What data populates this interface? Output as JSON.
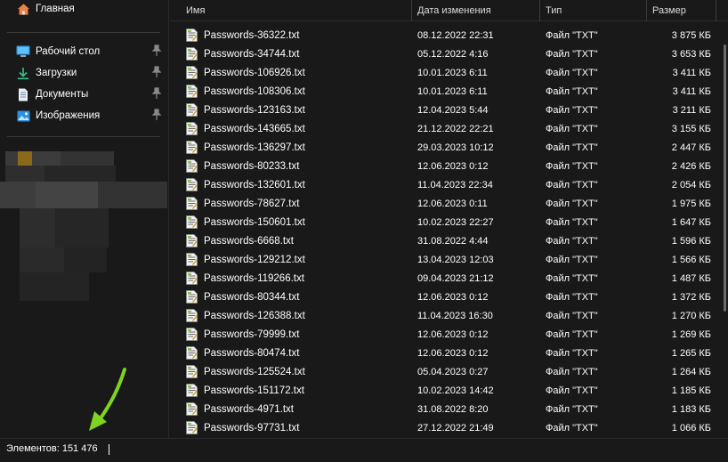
{
  "sidebar": {
    "home": {
      "label": "Главная",
      "icon": "home-icon"
    },
    "quick": [
      {
        "label": "Рабочий стол",
        "icon": "desktop-icon"
      },
      {
        "label": "Загрузки",
        "icon": "download-icon"
      },
      {
        "label": "Документы",
        "icon": "document-icon"
      },
      {
        "label": "Изображения",
        "icon": "image-icon"
      }
    ]
  },
  "columns": {
    "name": "Имя",
    "date": "Дата изменения",
    "type": "Тип",
    "size": "Размер"
  },
  "files": [
    {
      "name": "Passwords-36322.txt",
      "date": "08.12.2022 22:31",
      "type": "Файл \"TXT\"",
      "size": "3 875 КБ"
    },
    {
      "name": "Passwords-34744.txt",
      "date": "05.12.2022 4:16",
      "type": "Файл \"TXT\"",
      "size": "3 653 КБ"
    },
    {
      "name": "Passwords-106926.txt",
      "date": "10.01.2023 6:11",
      "type": "Файл \"TXT\"",
      "size": "3 411 КБ"
    },
    {
      "name": "Passwords-108306.txt",
      "date": "10.01.2023 6:11",
      "type": "Файл \"TXT\"",
      "size": "3 411 КБ"
    },
    {
      "name": "Passwords-123163.txt",
      "date": "12.04.2023 5:44",
      "type": "Файл \"TXT\"",
      "size": "3 211 КБ"
    },
    {
      "name": "Passwords-143665.txt",
      "date": "21.12.2022 22:21",
      "type": "Файл \"TXT\"",
      "size": "3 155 КБ"
    },
    {
      "name": "Passwords-136297.txt",
      "date": "29.03.2023 10:12",
      "type": "Файл \"TXT\"",
      "size": "2 447 КБ"
    },
    {
      "name": "Passwords-80233.txt",
      "date": "12.06.2023 0:12",
      "type": "Файл \"TXT\"",
      "size": "2 426 КБ"
    },
    {
      "name": "Passwords-132601.txt",
      "date": "11.04.2023 22:34",
      "type": "Файл \"TXT\"",
      "size": "2 054 КБ"
    },
    {
      "name": "Passwords-78627.txt",
      "date": "12.06.2023 0:11",
      "type": "Файл \"TXT\"",
      "size": "1 975 КБ"
    },
    {
      "name": "Passwords-150601.txt",
      "date": "10.02.2023 22:27",
      "type": "Файл \"TXT\"",
      "size": "1 647 КБ"
    },
    {
      "name": "Passwords-6668.txt",
      "date": "31.08.2022 4:44",
      "type": "Файл \"TXT\"",
      "size": "1 596 КБ"
    },
    {
      "name": "Passwords-129212.txt",
      "date": "13.04.2023 12:03",
      "type": "Файл \"TXT\"",
      "size": "1 566 КБ"
    },
    {
      "name": "Passwords-119266.txt",
      "date": "09.04.2023 21:12",
      "type": "Файл \"TXT\"",
      "size": "1 487 КБ"
    },
    {
      "name": "Passwords-80344.txt",
      "date": "12.06.2023 0:12",
      "type": "Файл \"TXT\"",
      "size": "1 372 КБ"
    },
    {
      "name": "Passwords-126388.txt",
      "date": "11.04.2023 16:30",
      "type": "Файл \"TXT\"",
      "size": "1 270 КБ"
    },
    {
      "name": "Passwords-79999.txt",
      "date": "12.06.2023 0:12",
      "type": "Файл \"TXT\"",
      "size": "1 269 КБ"
    },
    {
      "name": "Passwords-80474.txt",
      "date": "12.06.2023 0:12",
      "type": "Файл \"TXT\"",
      "size": "1 265 КБ"
    },
    {
      "name": "Passwords-125524.txt",
      "date": "05.04.2023 0:27",
      "type": "Файл \"TXT\"",
      "size": "1 264 КБ"
    },
    {
      "name": "Passwords-151172.txt",
      "date": "10.02.2023 14:42",
      "type": "Файл \"TXT\"",
      "size": "1 185 КБ"
    },
    {
      "name": "Passwords-4971.txt",
      "date": "31.08.2022 8:20",
      "type": "Файл \"TXT\"",
      "size": "1 183 КБ"
    },
    {
      "name": "Passwords-97731.txt",
      "date": "27.12.2022 21:49",
      "type": "Файл \"TXT\"",
      "size": "1 066 КБ"
    }
  ],
  "status": {
    "items": "Элементов: 151 476"
  },
  "colors": {
    "background": "#191919",
    "text": "#ffffff",
    "arrow": "#7ed321",
    "accent": "#3aa0e8"
  }
}
